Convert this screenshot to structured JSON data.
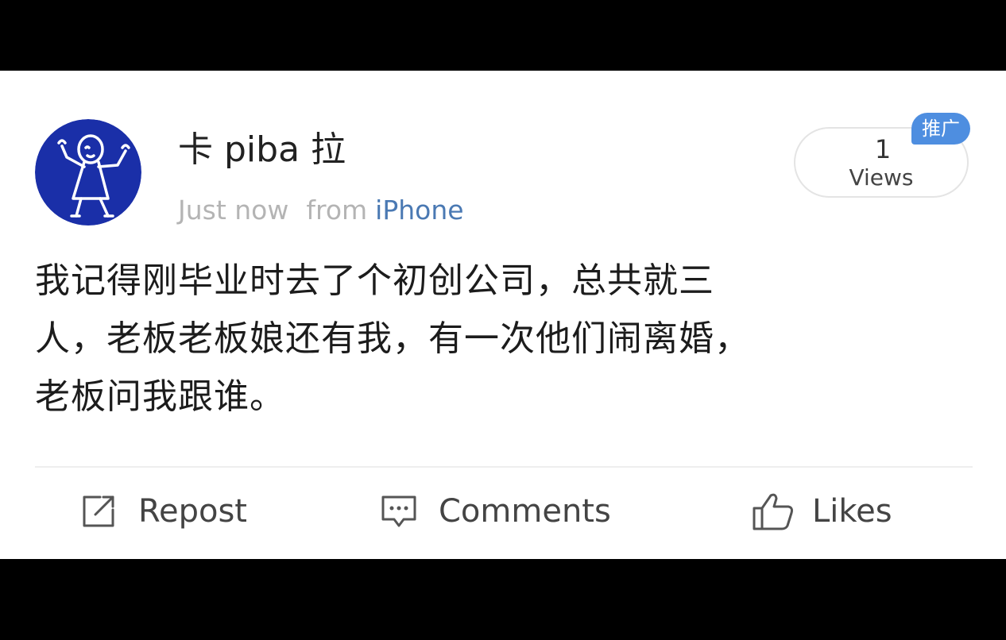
{
  "post": {
    "username": "卡 piba 拉",
    "timestamp": "Just now",
    "from_label": "from",
    "source": "iPhone",
    "views_count": "1",
    "views_label": "Views",
    "promo_badge": "推广",
    "text_lines": [
      "我记得刚毕业时去了个初创公司，总共就三",
      "人，老板老板娘还有我，有一次他们闹离婚，",
      "老板问我跟谁。"
    ],
    "avatar_icon": "dancing-stick-figure-icon"
  },
  "actions": {
    "repost_label": "Repost",
    "comments_label": "Comments",
    "likes_label": "Likes",
    "repost_icon": "repost-icon",
    "comments_icon": "comment-icon",
    "likes_icon": "thumbs-up-icon"
  },
  "colors": {
    "avatar_bg": "#1a2fa8",
    "source_link": "#4a79b3",
    "promo_badge": "#4e8ee0",
    "meta_gray": "#b4b4b4"
  }
}
